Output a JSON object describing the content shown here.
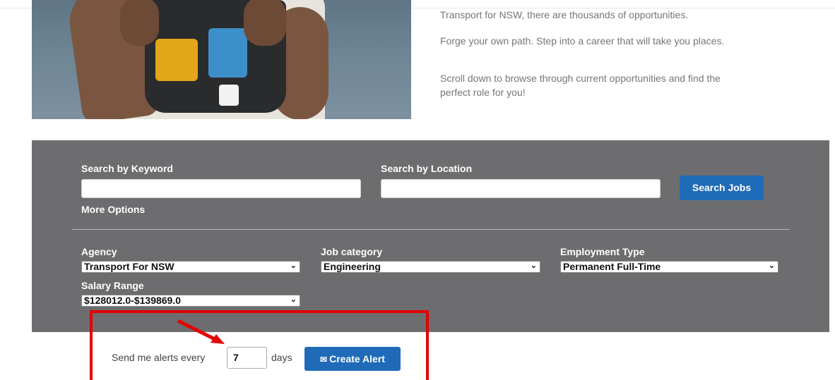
{
  "intro": {
    "line1": "Transport for NSW, there are thousands of opportunities.",
    "para2": "Forge your own path. Step into a career that will take you places.",
    "para3": "Scroll down to browse through current opportunities and find the perfect role for you!"
  },
  "search": {
    "keyword_label": "Search by Keyword",
    "keyword_value": "",
    "location_label": "Search by Location",
    "location_value": "",
    "search_button": "Search Jobs",
    "more_options": "More Options"
  },
  "filters": {
    "agency_label": "Agency",
    "agency_value": "Transport For NSW",
    "category_label": "Job category",
    "category_value": "Engineering",
    "employment_label": "Employment Type",
    "employment_value": "Permanent Full-Time",
    "salary_label": "Salary Range",
    "salary_value": "$128012.0-$139869.0"
  },
  "alert": {
    "prefix": "Send me alerts every",
    "days_value": "7",
    "suffix": "days",
    "button": "Create Alert"
  },
  "colors": {
    "panel": "#6d6d70",
    "primary_button": "#1f6bb8",
    "annotation": "#e30000"
  }
}
